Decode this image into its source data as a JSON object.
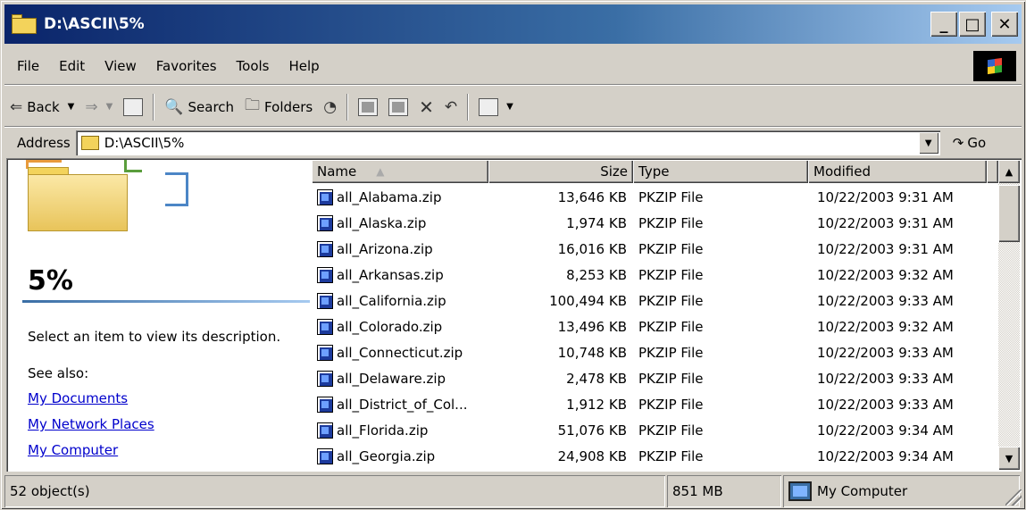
{
  "window": {
    "title": "D:\\ASCII\\5%"
  },
  "title_buttons": {
    "minimize": "_",
    "maximize": "□",
    "close": "✕"
  },
  "menu": [
    {
      "label": "File"
    },
    {
      "label": "Edit"
    },
    {
      "label": "View"
    },
    {
      "label": "Favorites"
    },
    {
      "label": "Tools"
    },
    {
      "label": "Help"
    }
  ],
  "toolbar": {
    "back_label": "Back",
    "search_label": "Search",
    "folders_label": "Folders"
  },
  "address": {
    "label": "Address",
    "value": "D:\\ASCII\\5%",
    "go_label": "Go"
  },
  "left_pane": {
    "title": "5%",
    "description": "Select an item to view its description.",
    "see_also": "See also:",
    "links": [
      "My Documents",
      "My Network Places",
      "My Computer"
    ]
  },
  "columns": {
    "name": "Name",
    "size": "Size",
    "type": "Type",
    "modified": "Modified"
  },
  "files": [
    {
      "name": "all_Alabama.zip",
      "size": "13,646 KB",
      "type": "PKZIP File",
      "modified": "10/22/2003 9:31 AM"
    },
    {
      "name": "all_Alaska.zip",
      "size": "1,974 KB",
      "type": "PKZIP File",
      "modified": "10/22/2003 9:31 AM"
    },
    {
      "name": "all_Arizona.zip",
      "size": "16,016 KB",
      "type": "PKZIP File",
      "modified": "10/22/2003 9:31 AM"
    },
    {
      "name": "all_Arkansas.zip",
      "size": "8,253 KB",
      "type": "PKZIP File",
      "modified": "10/22/2003 9:32 AM"
    },
    {
      "name": "all_California.zip",
      "size": "100,494 KB",
      "type": "PKZIP File",
      "modified": "10/22/2003 9:33 AM"
    },
    {
      "name": "all_Colorado.zip",
      "size": "13,496 KB",
      "type": "PKZIP File",
      "modified": "10/22/2003 9:32 AM"
    },
    {
      "name": "all_Connecticut.zip",
      "size": "10,748 KB",
      "type": "PKZIP File",
      "modified": "10/22/2003 9:33 AM"
    },
    {
      "name": "all_Delaware.zip",
      "size": "2,478 KB",
      "type": "PKZIP File",
      "modified": "10/22/2003 9:33 AM"
    },
    {
      "name": "all_District_of_Col...",
      "size": "1,912 KB",
      "type": "PKZIP File",
      "modified": "10/22/2003 9:33 AM"
    },
    {
      "name": "all_Florida.zip",
      "size": "51,076 KB",
      "type": "PKZIP File",
      "modified": "10/22/2003 9:34 AM"
    },
    {
      "name": "all_Georgia.zip",
      "size": "24,908 KB",
      "type": "PKZIP File",
      "modified": "10/22/2003 9:34 AM"
    }
  ],
  "status": {
    "objects": "52 object(s)",
    "size": "851 MB",
    "location": "My Computer"
  }
}
